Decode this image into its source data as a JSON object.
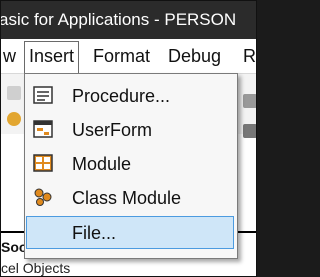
{
  "title": "asic for Applications - PERSON",
  "menubar": {
    "items": [
      {
        "label": "w",
        "open": false
      },
      {
        "label": "Insert",
        "open": true
      },
      {
        "label": "Format",
        "open": false
      },
      {
        "label": "Debug",
        "open": false
      },
      {
        "label": "R",
        "open": false
      }
    ]
  },
  "insert_menu": {
    "items": [
      {
        "label": "Procedure...",
        "icon": "procedure-icon",
        "selected": false
      },
      {
        "label": "UserForm",
        "icon": "userform-icon",
        "selected": false
      },
      {
        "label": "Module",
        "icon": "module-icon",
        "selected": false
      },
      {
        "label": "Class Module",
        "icon": "class-module-icon",
        "selected": false
      },
      {
        "label": "File...",
        "icon": "",
        "selected": true
      }
    ]
  },
  "project_panel": {
    "heading": "Soo",
    "item": "cel Objects"
  },
  "colors": {
    "titlebar": "#2b2b2b",
    "menu_highlight": "#cfe6f8",
    "menu_highlight_border": "#4c9be0",
    "module_icon": "#e08a1e"
  }
}
